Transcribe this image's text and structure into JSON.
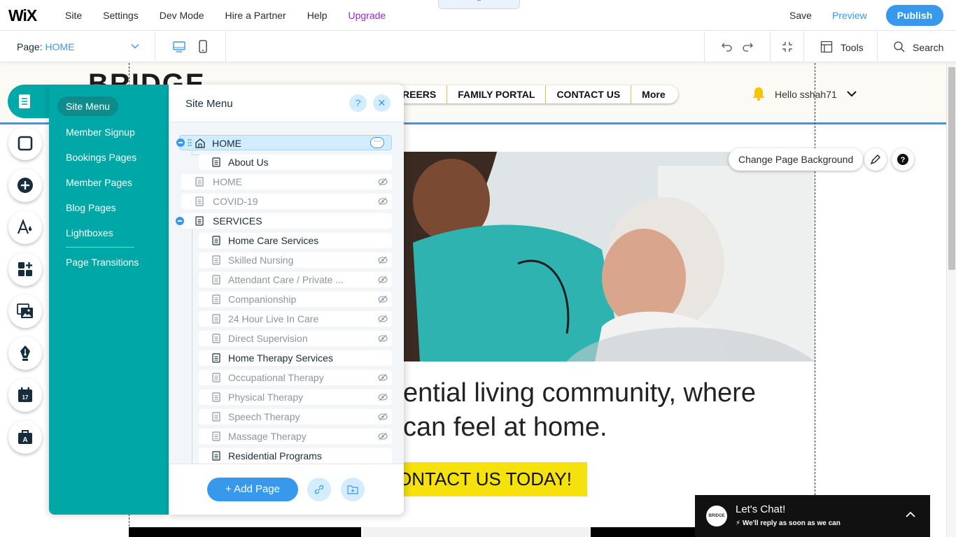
{
  "topbar": {
    "logo": "WiX",
    "menu": [
      "Site",
      "Settings",
      "Dev Mode",
      "Hire a Partner",
      "Help",
      "Upgrade"
    ],
    "save": "Save",
    "preview": "Preview",
    "publish": "Publish"
  },
  "subbar": {
    "page_label": "Page:",
    "page_value": "HOME",
    "tools": "Tools",
    "search": "Search"
  },
  "site": {
    "brand": "BRIDGE",
    "nav": [
      "REERS",
      "FAMILY PORTAL",
      "CONTACT US",
      "More"
    ],
    "greeting": "Hello sshah71",
    "change_bg": "Change Page Background",
    "headline_1": "ential living community, where",
    "headline_2": "can feel at home.",
    "cta": "ONTACT US TODAY!"
  },
  "chat": {
    "avatar": "BRIDGE",
    "title": "Let's Chat!",
    "subtitle": "We'll reply as soon as we can"
  },
  "panel": {
    "categories": [
      "Site Menu",
      "Member Signup",
      "Bookings Pages",
      "Member Pages",
      "Blog Pages",
      "Lightboxes",
      "Page Transitions"
    ],
    "title": "Site Menu",
    "help": "?",
    "close": "✕",
    "pages": [
      {
        "label": "HOME",
        "level": 0,
        "hidden": false,
        "home": true,
        "selected": true,
        "collapsible": true
      },
      {
        "label": "About Us",
        "level": 1,
        "hidden": false
      },
      {
        "label": "HOME",
        "level": 0,
        "hidden": true
      },
      {
        "label": "COVID-19",
        "level": 0,
        "hidden": true
      },
      {
        "label": "SERVICES",
        "level": 0,
        "hidden": false,
        "collapsible": true
      },
      {
        "label": "Home Care Services",
        "level": 1,
        "hidden": false
      },
      {
        "label": "Skilled Nursing",
        "level": 1,
        "hidden": true
      },
      {
        "label": "Attendant Care / Private ...",
        "level": 1,
        "hidden": true
      },
      {
        "label": "Companionship",
        "level": 1,
        "hidden": true
      },
      {
        "label": "24 Hour Live In Care",
        "level": 1,
        "hidden": true
      },
      {
        "label": "Direct Supervision",
        "level": 1,
        "hidden": true
      },
      {
        "label": "Home Therapy Services",
        "level": 1,
        "hidden": false
      },
      {
        "label": "Occupational Therapy",
        "level": 1,
        "hidden": true
      },
      {
        "label": "Physical Therapy",
        "level": 1,
        "hidden": true
      },
      {
        "label": "Speech Therapy",
        "level": 1,
        "hidden": true
      },
      {
        "label": "Massage Therapy",
        "level": 1,
        "hidden": true
      },
      {
        "label": "Residential Programs",
        "level": 1,
        "hidden": false
      }
    ],
    "add_page": "+ Add Page"
  },
  "colors": {
    "accent": "#3899ec",
    "panel_teal": "#00a7a7",
    "upgrade": "#9a27d5",
    "cta_yellow": "#f5e10b"
  }
}
